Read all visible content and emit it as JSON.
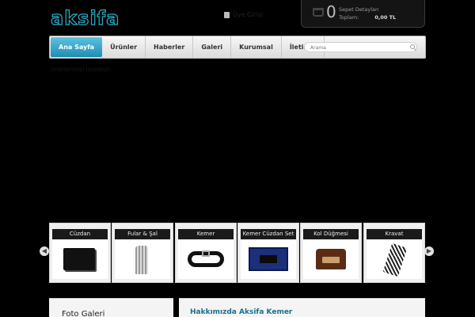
{
  "logo": {
    "text": "aksifa"
  },
  "top_link": {
    "label": "Üye Girişi"
  },
  "cart": {
    "count": "0",
    "label": "Sepet Detayları",
    "total_label": "Toplam:",
    "total_value": "0,00 TL"
  },
  "nav": {
    "items": [
      {
        "label": "Ana Sayfa",
        "active": true
      },
      {
        "label": "Ürünler"
      },
      {
        "label": "Haberler"
      },
      {
        "label": "Galeri"
      },
      {
        "label": "Kurumsal"
      },
      {
        "label": "İletisim"
      }
    ],
    "search_placeholder": "Arama"
  },
  "breadcrumb": {
    "text": "Ürünlerimizi İnceleyin"
  },
  "categories": [
    {
      "label": "Cüzdan",
      "image": "wallet"
    },
    {
      "label": "Fular & Şal",
      "image": "scarf"
    },
    {
      "label": "Kemer",
      "image": "belt"
    },
    {
      "label": "Kemer Cüzdan Set",
      "image": "gift-box"
    },
    {
      "label": "Kol Düğmesi",
      "image": "jewelry-box"
    },
    {
      "label": "Kravat",
      "image": "tie"
    }
  ],
  "panels": {
    "left_title": "Foto Galeri",
    "right_title": "Hakkımızda Aksifa Kemer"
  },
  "colors": {
    "accent": "#2ab0c8",
    "nav_active": "#1f8cb2",
    "background": "#000000"
  }
}
